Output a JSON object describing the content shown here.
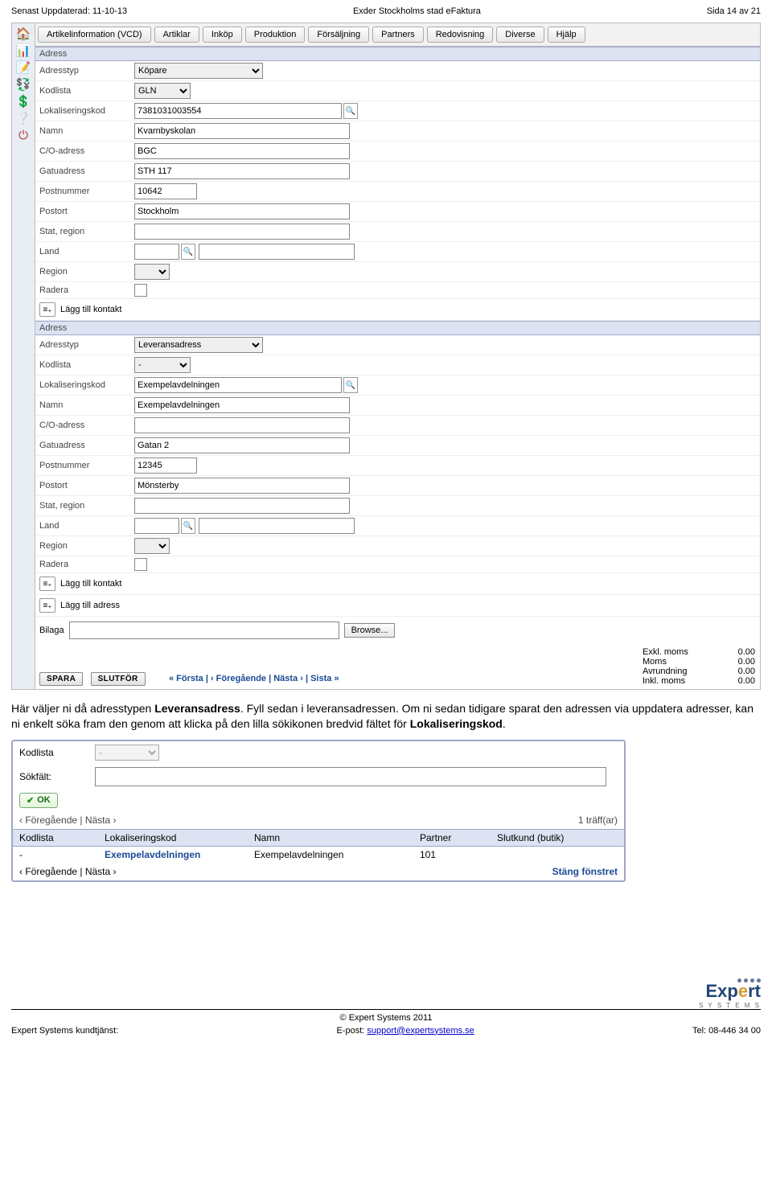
{
  "header": {
    "updated": "Senast Uppdaterad: 11-10-13",
    "title": "Exder Stockholms stad eFaktura",
    "page": "Sida 14 av 21"
  },
  "topmenu": [
    "Artikelinformation (VCD)",
    "Artiklar",
    "Inköp",
    "Produktion",
    "Försäljning",
    "Partners",
    "Redovisning",
    "Diverse",
    "Hjälp"
  ],
  "section_label": "Adress",
  "labels": {
    "adresstyp": "Adresstyp",
    "kodlista": "Kodlista",
    "lokkod": "Lokaliseringskod",
    "namn": "Namn",
    "co": "C/O-adress",
    "gatu": "Gatuadress",
    "postnr": "Postnummer",
    "postort": "Postort",
    "stat": "Stat, region",
    "land": "Land",
    "region": "Region",
    "radera": "Radera"
  },
  "addr1": {
    "adresstyp": "Köpare",
    "kodlista": "GLN",
    "lokkod": "7381031003554",
    "namn": "Kvarnbyskolan",
    "co": "BGC",
    "gatu": "STH 117",
    "postnr": "10642",
    "postort": "Stockholm",
    "stat": "",
    "land": "",
    "region": ""
  },
  "addr2": {
    "adresstyp": "Leveransadress",
    "kodlista": "-",
    "lokkod": "Exempelavdelningen",
    "namn": "Exempelavdelningen",
    "co": "",
    "gatu": "Gatan 2",
    "postnr": "12345",
    "postort": "Mönsterby",
    "stat": "",
    "land": "",
    "region": ""
  },
  "add_contact": "Lägg till kontakt",
  "add_address": "Lägg till adress",
  "bilaga_label": "Bilaga",
  "browse": "Browse...",
  "totals": {
    "excl": "Exkl. moms",
    "moms": "Moms",
    "avr": "Avrundning",
    "incl": "Inkl. moms",
    "v_excl": "0.00",
    "v_moms": "0.00",
    "v_avr": "0.00",
    "v_incl": "0.00"
  },
  "pager": "« Första | ‹ Föregående | Nästa › | Sista »",
  "btn_save": "SPARA",
  "btn_done": "SLUTFÖR",
  "paragraph": {
    "p1a": "Här väljer ni då adresstypen ",
    "p1b": "Leveransadress",
    "p1c": ". Fyll sedan i leveransadressen. Om ni sedan tidigare sparat den adressen via uppdatera adresser, kan ni enkelt söka fram den genom att klicka på den lilla sökikonen bredvid fältet för ",
    "p1d": "Lokaliseringskod",
    "p1e": "."
  },
  "search": {
    "kodlista_lbl": "Kodlista",
    "kodlista_val": "-",
    "sokfalt_lbl": "Sökfält:",
    "sokfalt_val": "",
    "ok": "OK",
    "pager1": "‹ Föregående | Nästa ›",
    "hits": "1 träff(ar)",
    "cols": {
      "c1": "Kodlista",
      "c2": "Lokaliseringskod",
      "c3": "Namn",
      "c4": "Partner",
      "c5": "Slutkund (butik)"
    },
    "row": {
      "c1": "-",
      "c2": "Exempelavdelningen",
      "c3": "Exempelavdelningen",
      "c4": "101",
      "c5": ""
    },
    "pager2": "‹ Föregående | Nästa ›",
    "close": "Stäng fönstret"
  },
  "footer": {
    "copyright": "© Expert Systems 2011",
    "left": "Expert Systems kundtjänst:",
    "mid_pre": "E-post: ",
    "mid_link": "support@expertsystems.se",
    "right": "Tel: 08-446 34 00",
    "logo1": "Exp",
    "logo2": "e",
    "logo3": "rt",
    "logo_sub": "S Y S T E M S"
  }
}
